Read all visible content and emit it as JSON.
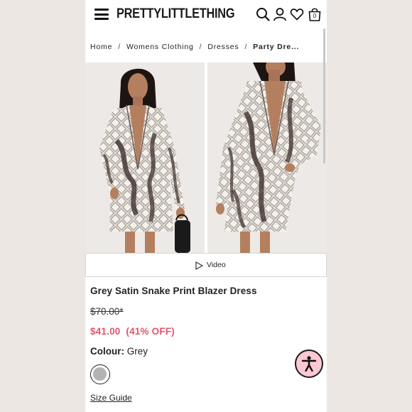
{
  "header": {
    "brand": "PRETTYLITTLETHING",
    "cart_count": "0",
    "icons": [
      "menu-icon",
      "search-icon",
      "account-icon",
      "wishlist-icon",
      "cart-icon"
    ]
  },
  "breadcrumb": {
    "items": [
      "Home",
      "Womens Clothing",
      "Dresses",
      "Party Dre..."
    ],
    "separator": "/"
  },
  "gallery": {
    "images": [
      "model-front-photo",
      "model-side-photo"
    ],
    "video_label": "Video"
  },
  "product": {
    "title": "Grey Satin Snake Print Blazer Dress",
    "original_price": "$70.00*",
    "sale_price": "$41.00",
    "discount": "(41% OFF)",
    "colour_label": "Colour:",
    "colour_value": "Grey",
    "swatch_color": "#b3b3b3",
    "size_guide": "Size Guide"
  },
  "colors": {
    "sale": "#e2556b",
    "accessibility_bg": "#fbc8d4",
    "page_bg": "#ede7e3"
  }
}
